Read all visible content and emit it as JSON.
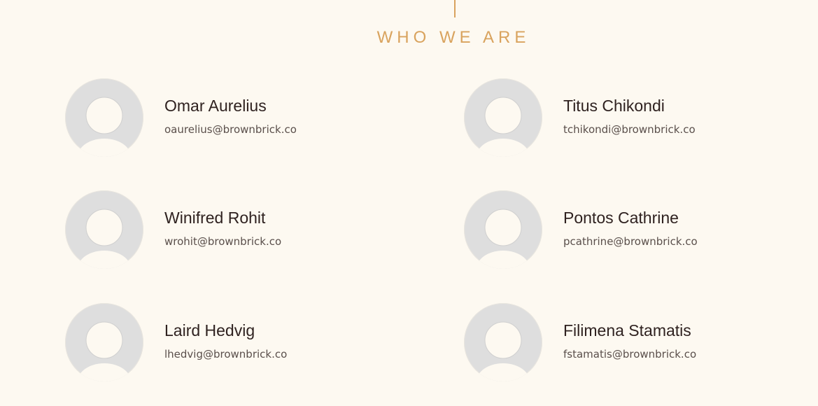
{
  "section": {
    "title": "WHO WE ARE"
  },
  "colors": {
    "background": "#fdf9f1",
    "accent": "#d9a35e",
    "name_text": "#2f2220",
    "email_text": "#5a4f4b",
    "avatar_bg": "#dedede"
  },
  "members": [
    {
      "name": "Omar Aurelius",
      "email": "oaurelius@brownbrick.co",
      "avatar_icon": "user-placeholder-icon"
    },
    {
      "name": "Titus Chikondi",
      "email": "tchikondi@brownbrick.co",
      "avatar_icon": "user-placeholder-icon"
    },
    {
      "name": "Winifred Rohit",
      "email": "wrohit@brownbrick.co",
      "avatar_icon": "user-placeholder-icon"
    },
    {
      "name": "Pontos Cathrine",
      "email": "pcathrine@brownbrick.co",
      "avatar_icon": "user-placeholder-icon"
    },
    {
      "name": "Laird Hedvig",
      "email": "lhedvig@brownbrick.co",
      "avatar_icon": "user-placeholder-icon"
    },
    {
      "name": "Filimena Stamatis",
      "email": "fstamatis@brownbrick.co",
      "avatar_icon": "user-placeholder-icon"
    }
  ]
}
